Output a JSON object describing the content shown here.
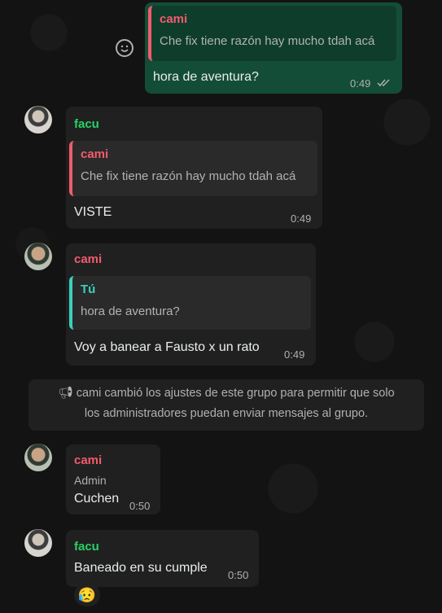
{
  "messages": [
    {
      "quote_name": "cami",
      "quote_text": "Che fix tiene razón hay mucho tdah acá",
      "text": "hora de aventura?",
      "time": "0:49"
    },
    {
      "sender": "facu",
      "quote_name": "cami",
      "quote_text": "Che fix tiene razón hay mucho tdah acá",
      "text": "VISTE",
      "time": "0:49"
    },
    {
      "sender": "cami",
      "quote_name": "Tú",
      "quote_text": "hora de aventura?",
      "text": "Voy a banear a Fausto x un rato",
      "time": "0:49"
    },
    {
      "system_line1": "cami cambió los ajustes de este grupo para permitir que solo",
      "system_line2": "los administradores puedan enviar mensajes al grupo."
    },
    {
      "sender": "cami",
      "role": "Admin",
      "text": "Cuchen",
      "time": "0:50"
    },
    {
      "sender": "facu",
      "text": "Baneado en su cumple",
      "time": "0:50",
      "reaction": "😥"
    }
  ]
}
